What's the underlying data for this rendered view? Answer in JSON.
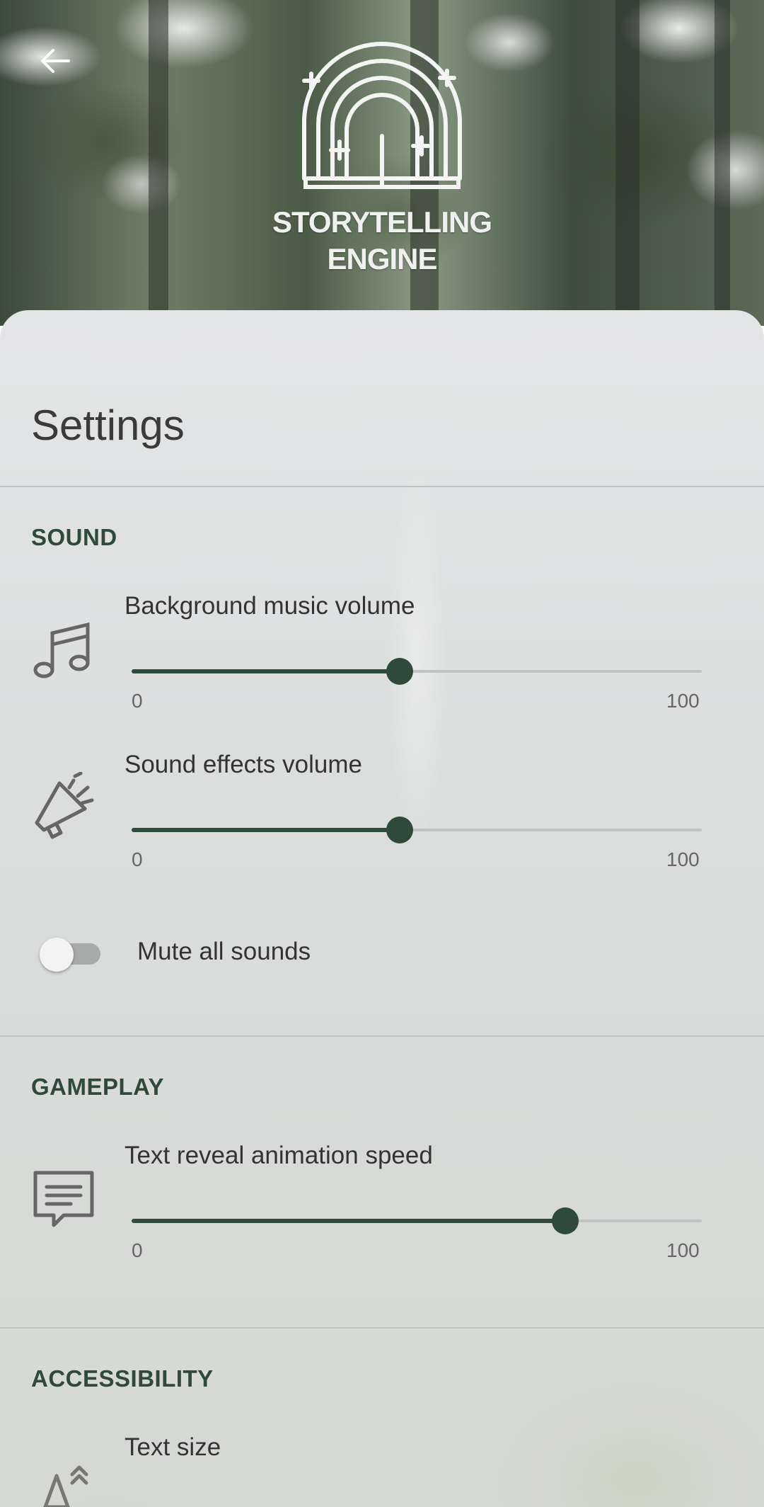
{
  "header": {
    "logo_line1": "STORYTELLING",
    "logo_line2": "ENGINE",
    "back_icon": "arrow-left-icon"
  },
  "settings": {
    "title": "Settings",
    "sound": {
      "section_title": "SOUND",
      "music": {
        "label": "Background music volume",
        "icon": "music-note-icon",
        "min_label": "0",
        "max_label": "100",
        "value": 47
      },
      "effects": {
        "label": "Sound effects volume",
        "icon": "megaphone-icon",
        "min_label": "0",
        "max_label": "100",
        "value": 47
      },
      "mute": {
        "label": "Mute all sounds",
        "enabled": false
      }
    },
    "gameplay": {
      "section_title": "GAMEPLAY",
      "text_speed": {
        "label": "Text reveal animation speed",
        "icon": "message-icon",
        "min_label": "0",
        "max_label": "100",
        "value": 76
      }
    },
    "accessibility": {
      "section_title": "ACCESSIBILITY",
      "text_size": {
        "label": "Text size",
        "icon": "text-size-icon"
      }
    }
  },
  "colors": {
    "accent": "#2f4a3a",
    "sheet": "#e0e1e2",
    "text": "#333333"
  }
}
